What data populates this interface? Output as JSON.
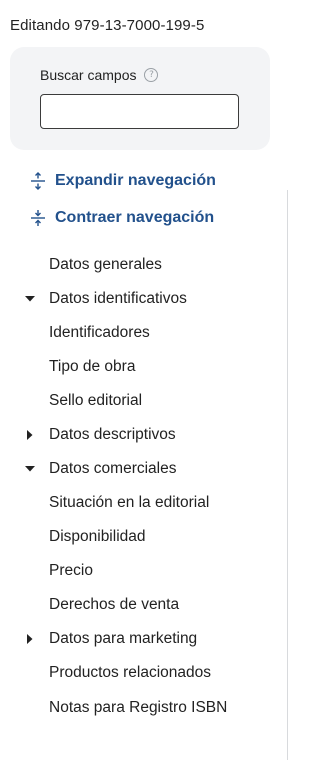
{
  "header": {
    "title": "Editando 979-13-7000-199-5"
  },
  "search": {
    "label": "Buscar campos",
    "help_glyph": "?",
    "value": "",
    "placeholder": ""
  },
  "navigation": {
    "expand_label": "Expandir navegación",
    "collapse_label": "Contraer navegación",
    "accent_color": "#22518c",
    "items": [
      {
        "label": "Datos generales",
        "caret": "none"
      },
      {
        "label": "Datos identificativos",
        "caret": "down"
      },
      {
        "label": "Identificadores",
        "caret": "none"
      },
      {
        "label": "Tipo de obra",
        "caret": "none"
      },
      {
        "label": "Sello editorial",
        "caret": "none"
      },
      {
        "label": "Datos descriptivos",
        "caret": "right"
      },
      {
        "label": "Datos comerciales",
        "caret": "down"
      },
      {
        "label": "Situación en la editorial",
        "caret": "none"
      },
      {
        "label": "Disponibilidad",
        "caret": "none"
      },
      {
        "label": "Precio",
        "caret": "none"
      },
      {
        "label": "Derechos de venta",
        "caret": "none"
      },
      {
        "label": "Datos para marketing",
        "caret": "right"
      },
      {
        "label": "Productos relacionados",
        "caret": "none"
      },
      {
        "label": "Notas para Registro ISBN",
        "caret": "none"
      }
    ]
  }
}
